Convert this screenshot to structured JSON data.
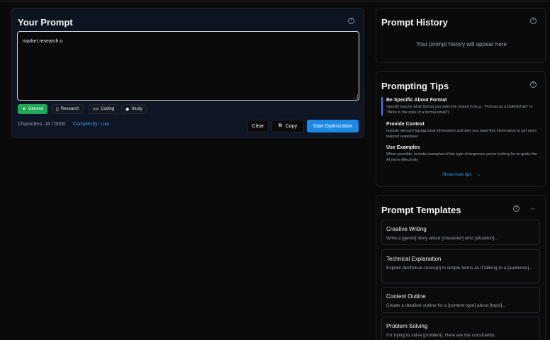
{
  "prompt": {
    "title": "Your Prompt",
    "value": "market research o",
    "categories": [
      {
        "label": "General",
        "icon": "lightbulb-icon"
      },
      {
        "label": "Research",
        "icon": "book-icon"
      },
      {
        "label": "Coding",
        "icon": "code-icon"
      },
      {
        "label": "Study",
        "icon": "graduation-cap-icon"
      }
    ],
    "characters": "Characters: 16 / 5000",
    "complexity": "Complexity: Low",
    "clear_label": "Clear",
    "copy_label": "Copy",
    "optimize_label": "Start Optimization"
  },
  "history": {
    "title": "Prompt History",
    "empty": "Your prompt history will appear here"
  },
  "tips": {
    "title": "Prompting Tips",
    "items": [
      {
        "title": "Be Specific About Format",
        "desc": "Specify exactly what format you want the output in (e.g., \"Format as a bulleted list\" or \"Write in the style of a formal email\")"
      },
      {
        "title": "Provide Context",
        "desc": "Include relevant background information and why you need this information to get more tailored responses"
      },
      {
        "title": "Use Examples",
        "desc": "When possible, include examples of the type of response you're looking for to guide the AI more effectively"
      }
    ],
    "show_more": "Show more tips"
  },
  "templates": {
    "title": "Prompt Templates",
    "items": [
      {
        "title": "Creative Writing",
        "desc": "Write a [genre] story about [character] who [situation]..."
      },
      {
        "title": "Technical Explanation",
        "desc": "Explain [technical concept] in simple terms as if talking to a [audience]..."
      },
      {
        "title": "Content Outline",
        "desc": "Create a detailed outline for a [content type] about [topic]..."
      },
      {
        "title": "Problem Solving",
        "desc": "I'm trying to solve [problem]. Here are the constraints:"
      }
    ]
  },
  "colors": {
    "accent": "#1e88e5",
    "active_category": "#21a857",
    "link": "#3b9eea"
  }
}
